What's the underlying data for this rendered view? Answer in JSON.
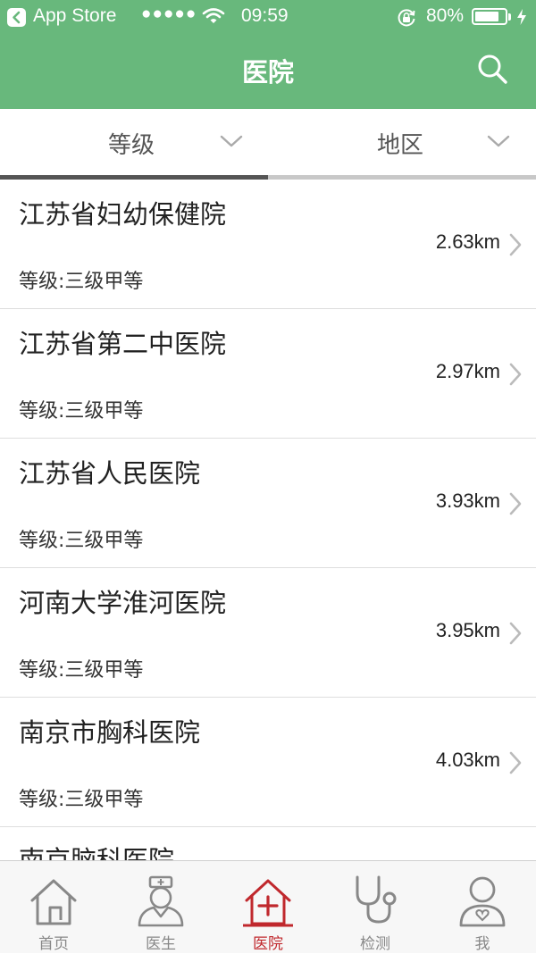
{
  "status_bar": {
    "back_app": "App Store",
    "signal": "●●●●●",
    "time": "09:59",
    "battery_percent": "80%",
    "battery_level": 0.8
  },
  "header": {
    "title": "医院"
  },
  "filters": [
    {
      "label": "等级",
      "icon": "chevron-down-icon"
    },
    {
      "label": "地区",
      "icon": "chevron-down-icon"
    }
  ],
  "hospitals": [
    {
      "name": "江苏省妇幼保健院",
      "grade": "等级:三级甲等",
      "distance": "2.63km"
    },
    {
      "name": "江苏省第二中医院",
      "grade": "等级:三级甲等",
      "distance": "2.97km"
    },
    {
      "name": "江苏省人民医院",
      "grade": "等级:三级甲等",
      "distance": "3.93km"
    },
    {
      "name": "河南大学淮河医院",
      "grade": "等级:三级甲等",
      "distance": "3.95km"
    },
    {
      "name": "南京市胸科医院",
      "grade": "等级:三级甲等",
      "distance": "4.03km"
    },
    {
      "name": "南京脑科医院"
    }
  ],
  "tabs": [
    {
      "label": "首页",
      "icon": "home-icon"
    },
    {
      "label": "医生",
      "icon": "doctor-icon"
    },
    {
      "label": "医院",
      "icon": "hospital-icon",
      "active": true
    },
    {
      "label": "检测",
      "icon": "stethoscope-icon"
    },
    {
      "label": "我",
      "icon": "profile-icon"
    }
  ],
  "colors": {
    "header_green": "#68b87c",
    "active_tab": "#c0282d",
    "inactive_tab": "#888888"
  }
}
